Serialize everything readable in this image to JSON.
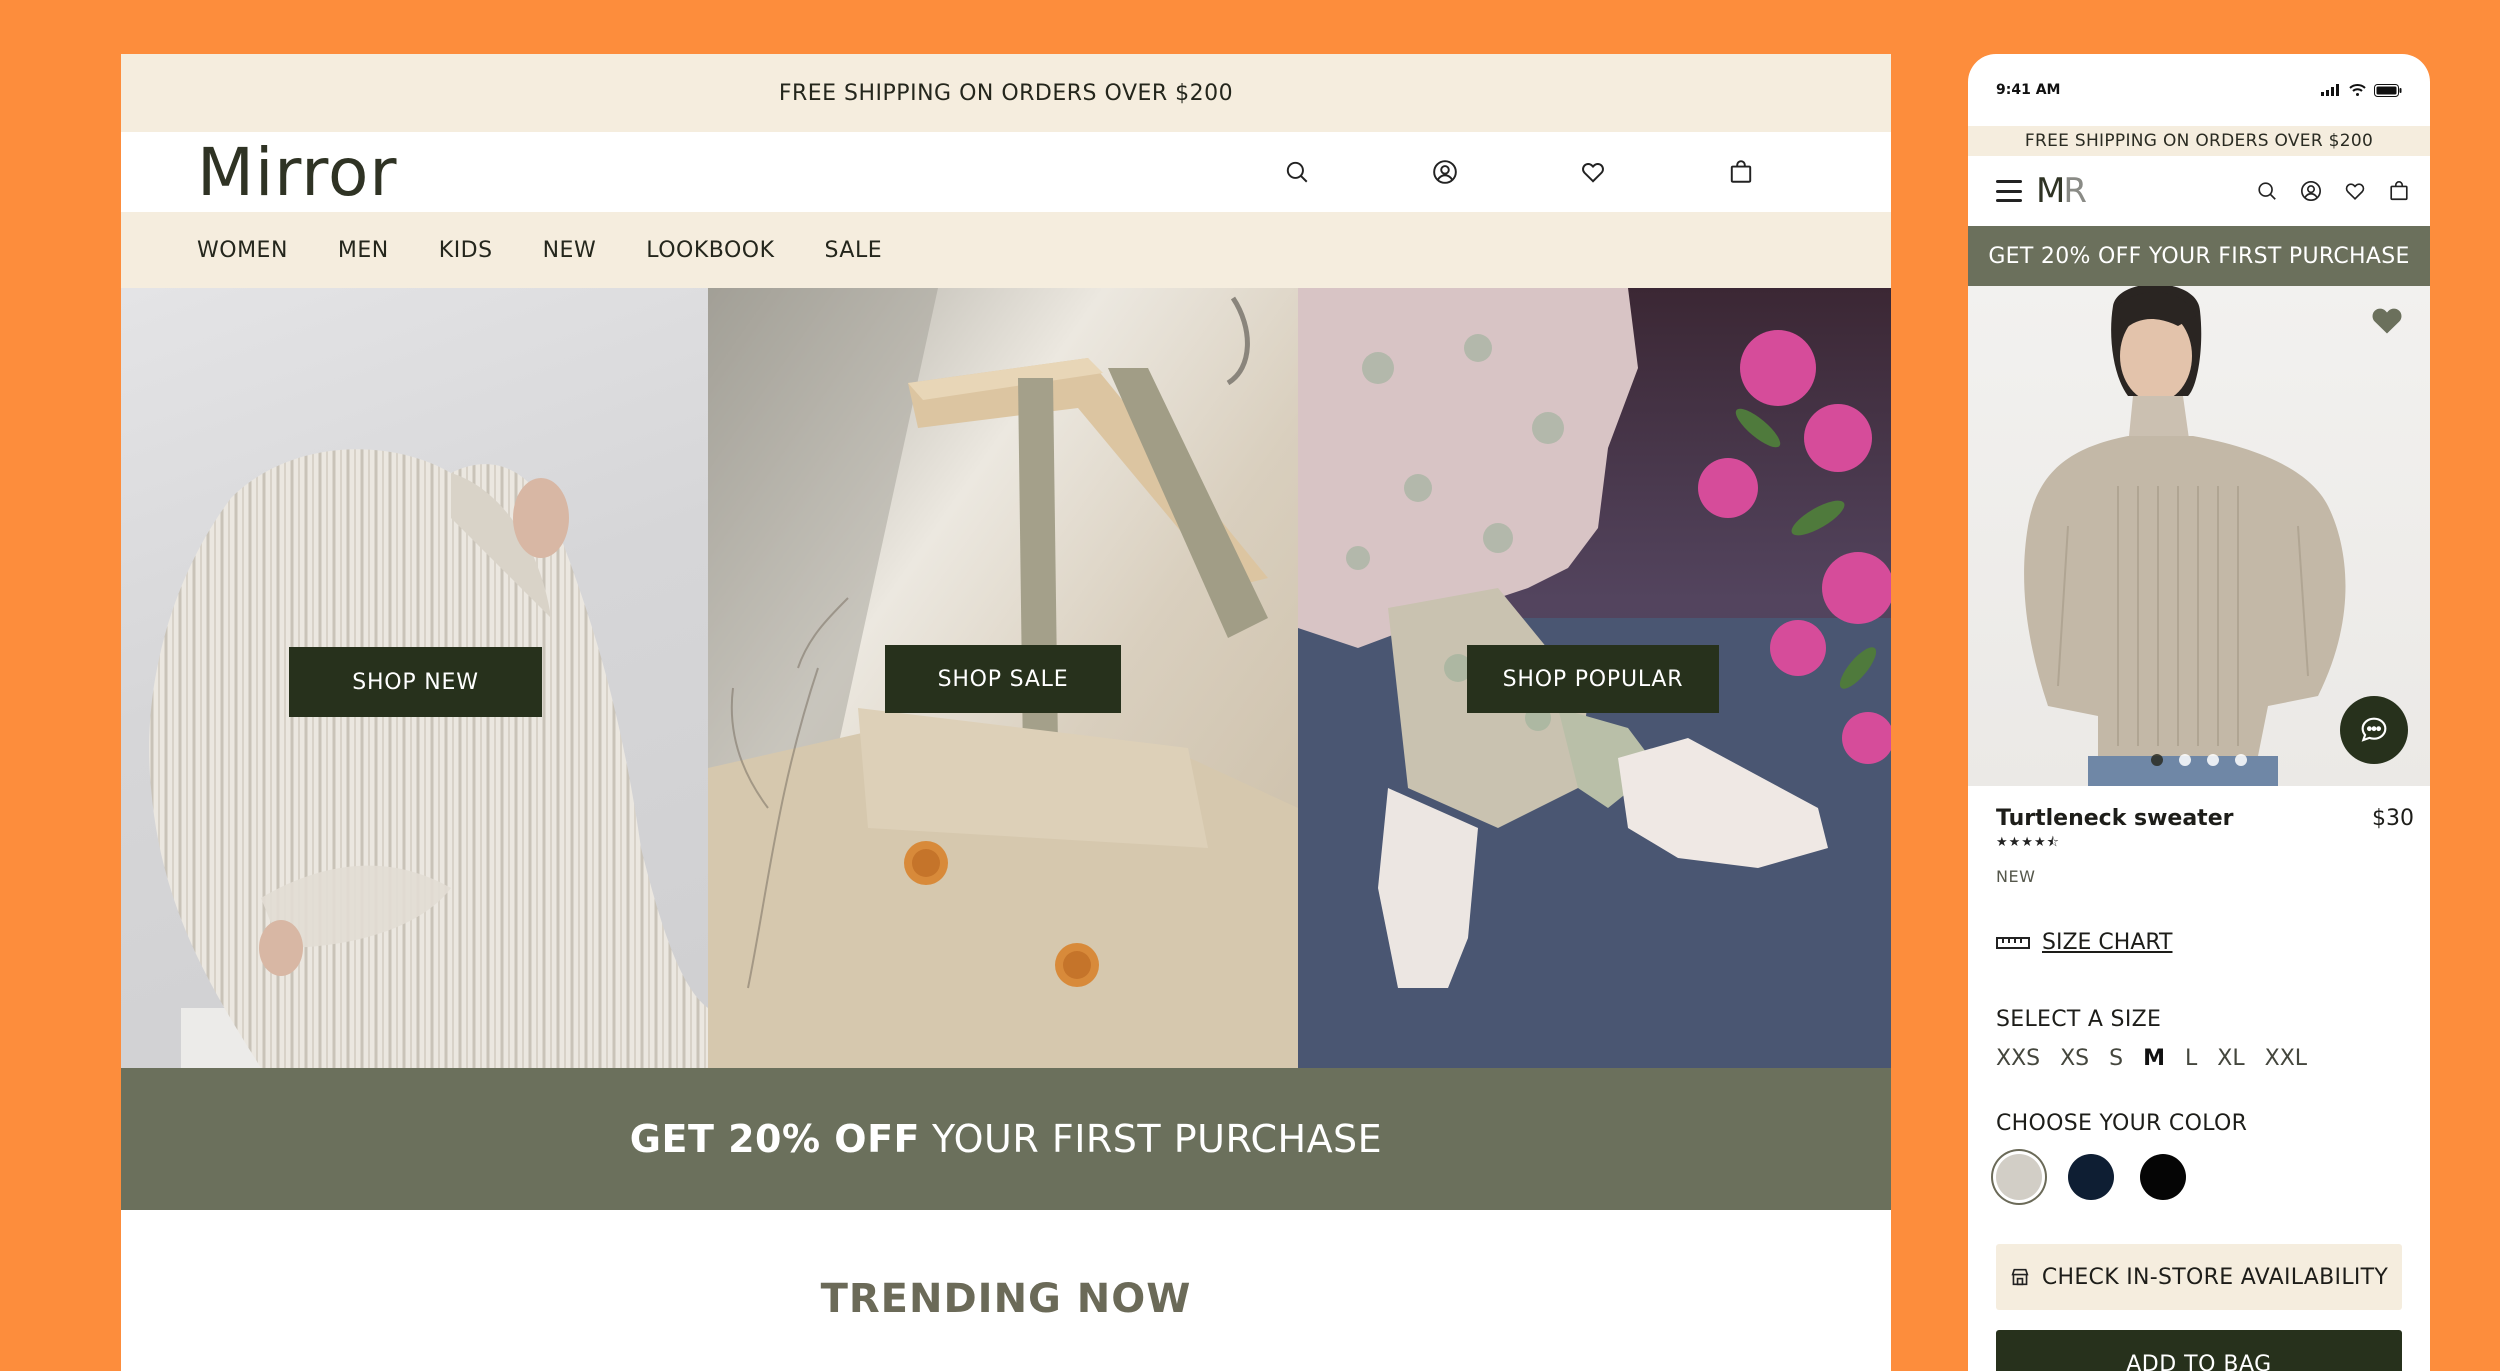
{
  "colors": {
    "background": "#FD8D3C",
    "cream": "#F5EDDE",
    "olive": "#6B705C",
    "dark_green": "#27311C",
    "heading_gray": "#6B6A58"
  },
  "desktop": {
    "promo_text": "FREE SHIPPING ON ORDERS OVER $200",
    "logo": "Mirror",
    "header_icons": [
      "search-icon",
      "account-icon",
      "wishlist-heart-icon",
      "shopping-bag-icon"
    ],
    "nav": [
      "WOMEN",
      "MEN",
      "KIDS",
      "NEW",
      "LOOKBOOK",
      "SALE"
    ],
    "hero": [
      {
        "image": "knit-sweater-photo",
        "button": "SHOP NEW"
      },
      {
        "image": "linen-overalls-on-hanger-photo",
        "button": "SHOP SALE"
      },
      {
        "image": "printed-pants-white-boots-photo",
        "button": "SHOP POPULAR"
      }
    ],
    "banner": {
      "bold": "GET 20% OFF",
      "rest": "YOUR FIRST PURCHASE"
    },
    "section_title": "TRENDING NOW"
  },
  "mobile": {
    "time": "9:41 AM",
    "status_icons": [
      "signal-icon",
      "wifi-icon",
      "battery-icon"
    ],
    "promo_text": "FREE SHIPPING ON ORDERS OVER $200",
    "logo_m": "M",
    "logo_r": "R",
    "header_icons": [
      "search-icon",
      "account-icon",
      "wishlist-heart-icon",
      "shopping-bag-icon"
    ],
    "banner": "GET 20% OFF YOUR FIRST PURCHASE",
    "product": {
      "name": "Turtleneck sweater",
      "price": "$30",
      "rating": 4.5,
      "stars": "★★★★⯪",
      "badge": "NEW",
      "image_count": 4,
      "active_image": 1
    },
    "size_chart_label": "SIZE CHART",
    "size_label": "SELECT A SIZE",
    "sizes": [
      "XXS",
      "XS",
      "S",
      "M",
      "L",
      "XL",
      "XXL"
    ],
    "selected_size": "M",
    "color_label": "CHOOSE YOUR COLOR",
    "color_swatches": [
      "#D2CEC6",
      "#0E1E33",
      "#050505"
    ],
    "selected_color": 0,
    "store_button": "CHECK IN-STORE AVAILABILITY",
    "add_button": "ADD TO BAG"
  }
}
